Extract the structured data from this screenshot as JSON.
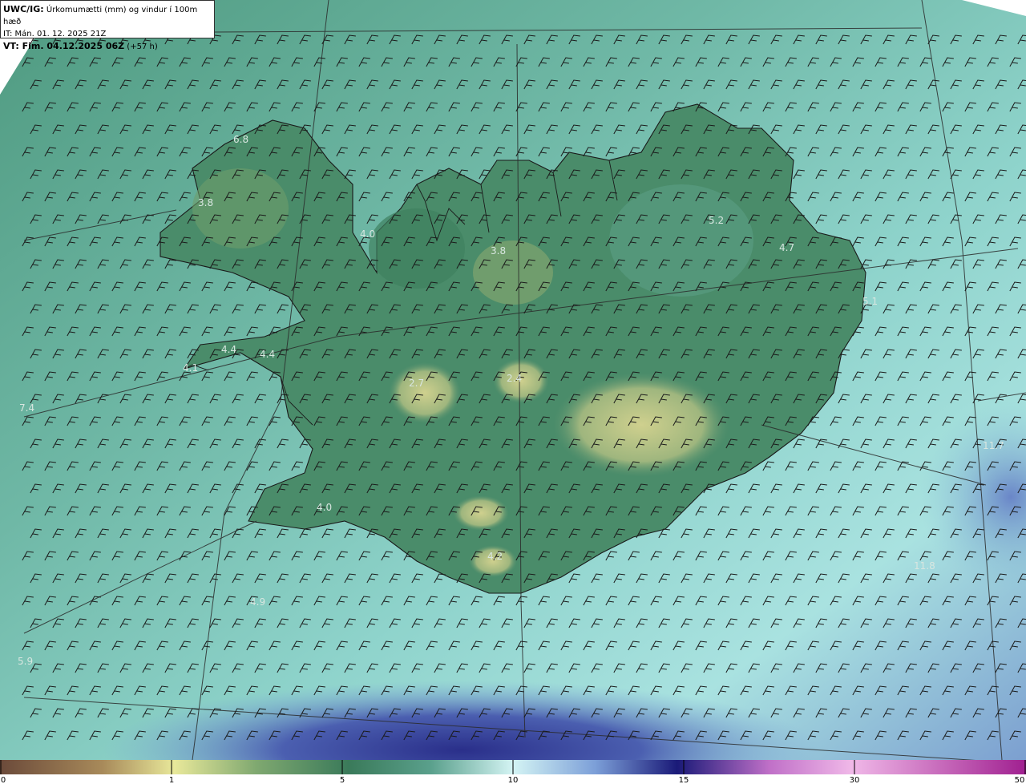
{
  "header": {
    "model": "UWC/IG:",
    "title": "Úrkomumætti (mm) og vindur í 100m hæð",
    "it": "IT: Mán. 01. 12. 2025 21Z",
    "vt_label": "VT: Fim. 04.12.2025 06Z",
    "vt_lead": "(+57 h)"
  },
  "map_values": [
    {
      "label": "6.8"
    },
    {
      "label": "3.8"
    },
    {
      "label": "4.0"
    },
    {
      "label": "3.8"
    },
    {
      "label": "5.2"
    },
    {
      "label": "4.7"
    },
    {
      "label": "5.1"
    },
    {
      "label": "4.4"
    },
    {
      "label": "4.4"
    },
    {
      "label": "4.1"
    },
    {
      "label": "7.4"
    },
    {
      "label": "2.7"
    },
    {
      "label": "2.4"
    },
    {
      "label": "4.0"
    },
    {
      "label": "4.2"
    },
    {
      "label": "4.9"
    },
    {
      "label": "5.9"
    },
    {
      "label": "11.7"
    },
    {
      "label": "11.8"
    }
  ],
  "colorbar": {
    "ticks": [
      "0",
      "1",
      "5",
      "10",
      "15",
      "30",
      "50"
    ],
    "colors": [
      "#6b4a3a",
      "#c8b37a",
      "#e8e89a",
      "#3a7a5a",
      "#7ec2b4",
      "#d4f4f4",
      "#5a6eb8",
      "#1a1a78",
      "#c070c8",
      "#f0b8e8",
      "#a02090"
    ]
  }
}
